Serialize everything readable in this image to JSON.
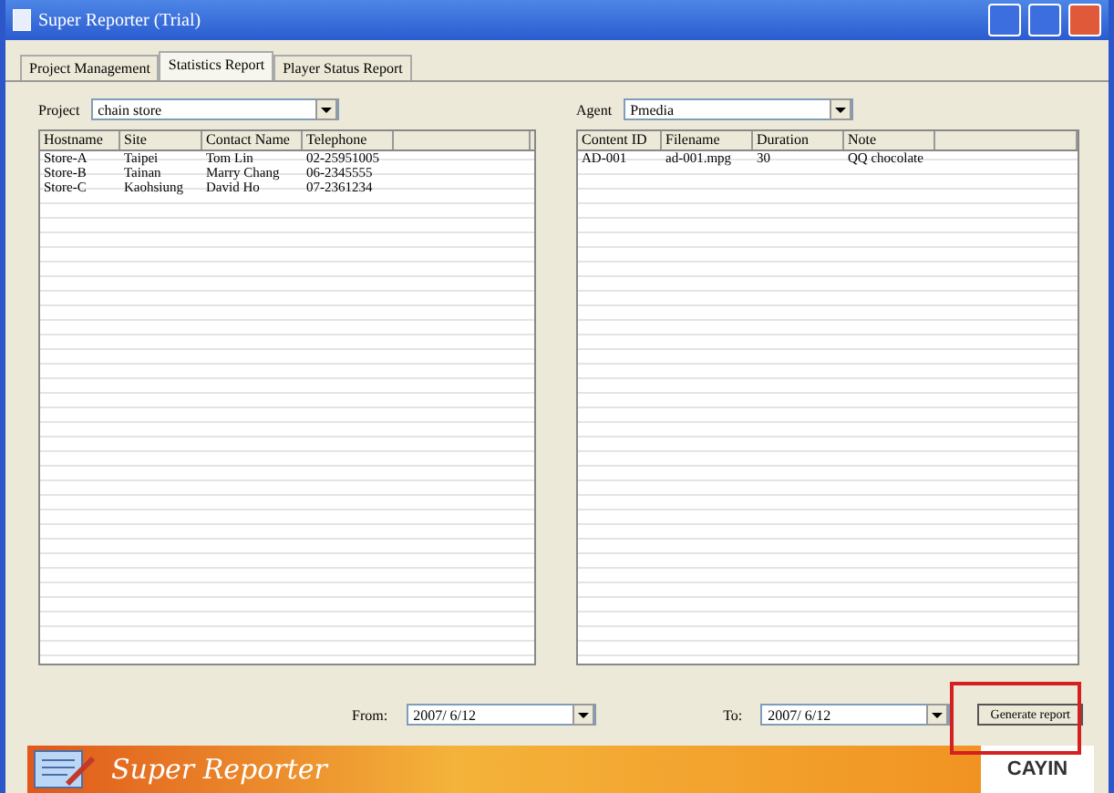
{
  "window": {
    "title": "Super Reporter (Trial)"
  },
  "tabs": [
    {
      "label": "Project Management",
      "selected": false
    },
    {
      "label": "Statistics Report",
      "selected": true
    },
    {
      "label": "Player Status Report",
      "selected": false
    }
  ],
  "project": {
    "label": "Project",
    "value": "chain store"
  },
  "agent": {
    "label": "Agent",
    "value": "Pmedia"
  },
  "left_table": {
    "columns": [
      "Hostname",
      "Site",
      "Contact Name",
      "Telephone"
    ],
    "rows": [
      [
        "Store-A",
        "Taipei",
        "Tom Lin",
        "02-25951005"
      ],
      [
        "Store-B",
        "Tainan",
        "Marry Chang",
        "06-2345555"
      ],
      [
        "Store-C",
        "Kaohsiung",
        "David Ho",
        "07-2361234"
      ]
    ]
  },
  "right_table": {
    "columns": [
      "Content ID",
      "Filename",
      "Duration",
      "Note"
    ],
    "rows": [
      [
        "AD-001",
        "ad-001.mpg",
        "30",
        "QQ chocolate"
      ]
    ]
  },
  "from": {
    "label": "From:",
    "value": "2007/ 6/12"
  },
  "to": {
    "label": "To:",
    "value": "2007/ 6/12"
  },
  "generate_button": "Generate report",
  "banner": {
    "title": "Super Reporter",
    "logo": "CAYIN"
  }
}
